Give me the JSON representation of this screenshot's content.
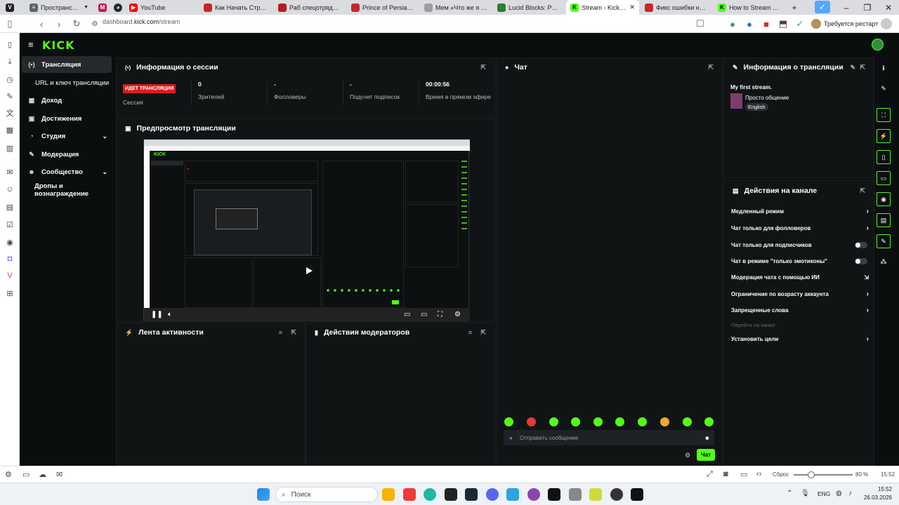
{
  "browser": {
    "tabs": [
      {
        "label": "Пространства",
        "color": "#5f6368"
      },
      {
        "label": "",
        "color": "#c2185b"
      },
      {
        "label": "",
        "color": "#24292e"
      },
      {
        "label": "YouTube",
        "color": "#ff0000"
      },
      {
        "label": "Как Начать Стримить",
        "color": "#c62828"
      },
      {
        "label": "Раб спецотряда демо",
        "color": "#b71c1c"
      },
      {
        "label": "Prince of Persia: Warri",
        "color": "#c62828"
      },
      {
        "label": "Мем «Что же я хочу с",
        "color": "#9e9e9e"
      },
      {
        "label": "Lucid Blocks: Руковод",
        "color": "#2e7d32"
      },
      {
        "label": "Stream - Kick Dashbo",
        "color": "#53fc18"
      },
      {
        "label": "Фикс ошибки на KICK",
        "color": "#c62828"
      },
      {
        "label": "How to Stream on Kick",
        "color": "#53fc18"
      }
    ],
    "new_tab": "+",
    "url_prefix": "dashboard.",
    "url_domain": "kick.com",
    "url_path": "/stream",
    "restart_label": "Требуется рестарт"
  },
  "kick": {
    "logo": "KICK",
    "nav": [
      {
        "label": "Трансляция",
        "icon": "(•)"
      },
      {
        "label": "URL и ключ трансляции",
        "icon": ""
      },
      {
        "label": "Доход",
        "icon": "▦"
      },
      {
        "label": "Достижения",
        "icon": "▣"
      },
      {
        "label": "Студия",
        "icon": "◔"
      },
      {
        "label": "Модерация",
        "icon": "✎"
      },
      {
        "label": "Сообщество",
        "icon": "☻"
      },
      {
        "label": "Дропы и вознаграждение",
        "icon": ""
      }
    ],
    "session": {
      "title": "Информация о сессии",
      "live_badge": "ИДЕТ ТРАНСЛЯЦИЯ",
      "sessions_label": "Сессия",
      "viewers_value": "0",
      "viewers_label": "Зрителей",
      "followers_value": "-",
      "followers_label": "Фолловеры",
      "subs_value": "-",
      "subs_label": "Подсчет подписок",
      "time_value": "00:00:56",
      "time_label": "Время в прямом эфире"
    },
    "preview_title": "Предпросмотр трансляции",
    "activity_title": "Лента активности",
    "mod_title": "Действия модераторов",
    "chat": {
      "title": "Чат",
      "placeholder": "Отправить сообщение",
      "send_label": "Чат"
    },
    "stream_info": {
      "title": "Информация о трансляции",
      "stream_title": "My first stream.",
      "category": "Просто общение",
      "language": "English"
    },
    "channel_actions": {
      "title": "Действия на канале",
      "items": [
        {
          "label": "Медленный режим",
          "type": "chevron"
        },
        {
          "label": "Чат только для фолловеров",
          "type": "chevron"
        },
        {
          "label": "Чат только для подписчиков",
          "type": "toggle"
        },
        {
          "label": "Чат в режиме \"только эмотиконы\"",
          "type": "toggle"
        },
        {
          "label": "Модерация чата с помощью ИИ",
          "type": "external"
        },
        {
          "label": "Ограничение по возрасту аккаунта",
          "type": "chevron"
        },
        {
          "label": "Запрещенные слова",
          "type": "chevron"
        },
        {
          "label": "Перейти на канал",
          "type": "disabled"
        },
        {
          "label": "Установить цели",
          "type": "chevron"
        }
      ]
    }
  },
  "bottom": {
    "reset_label": "Сброс",
    "zoom": "80 %",
    "zoom_fraction": 0.3,
    "time": "15:52"
  },
  "taskbar": {
    "search_placeholder": "Поиск",
    "lang": "ENG",
    "time": "15:52",
    "date": "26.03.2026"
  },
  "colors": {
    "accent": "#53fc18",
    "live": "#d81e1e"
  }
}
